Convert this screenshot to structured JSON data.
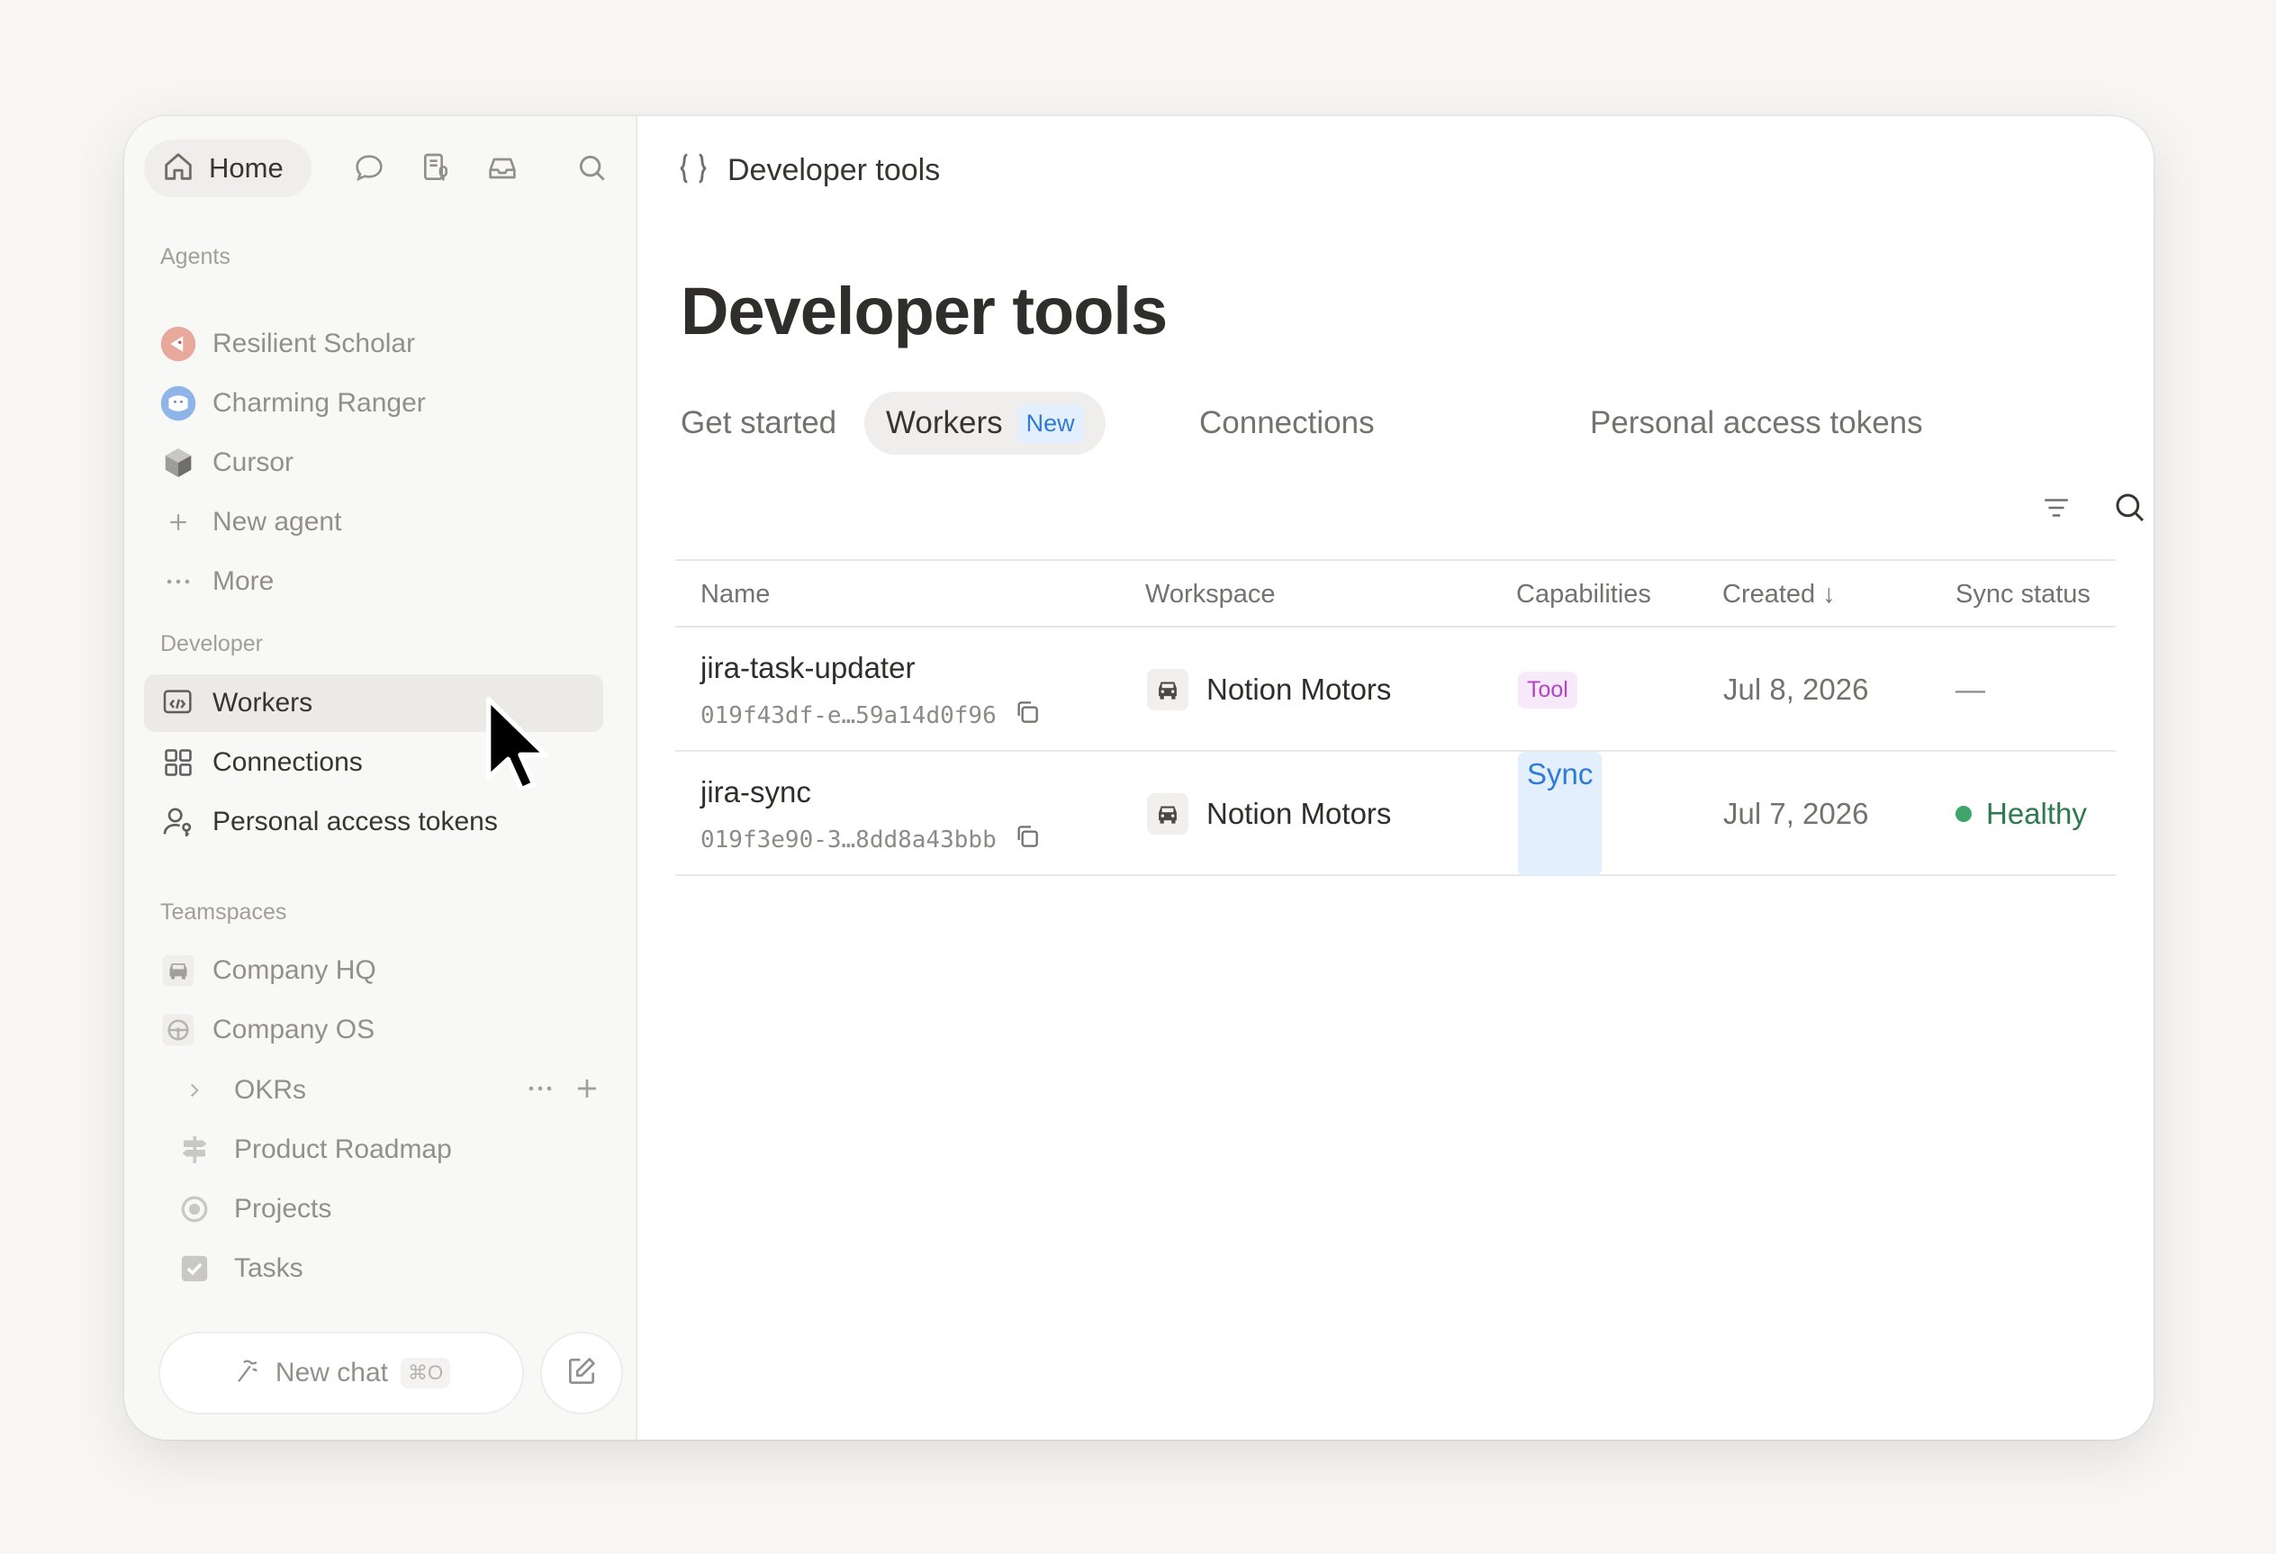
{
  "sidebar": {
    "home_label": "Home",
    "sections": {
      "agents": "Agents",
      "developer": "Developer",
      "teamspaces": "Teamspaces"
    },
    "agents": [
      {
        "label": "Resilient Scholar",
        "color": "#e9a89c"
      },
      {
        "label": "Charming Ranger",
        "color": "#8fb4e8"
      },
      {
        "label": "Cursor",
        "icon": "cube-icon"
      },
      {
        "label": "New agent",
        "icon": "plus-icon"
      },
      {
        "label": "More",
        "icon": "ellipsis-icon"
      }
    ],
    "developer": [
      {
        "label": "Workers",
        "icon": "code-window-icon"
      },
      {
        "label": "Connections",
        "icon": "grid-icon"
      },
      {
        "label": "Personal access tokens",
        "icon": "user-key-icon"
      }
    ],
    "teamspaces": [
      {
        "label": "Company HQ",
        "icon": "car-icon"
      },
      {
        "label": "Company OS",
        "icon": "steering-wheel-icon"
      },
      {
        "label": "OKRs",
        "icon": "chevron-right-icon"
      },
      {
        "label": "Product Roadmap",
        "icon": "signpost-icon"
      },
      {
        "label": "Projects",
        "icon": "target-icon"
      },
      {
        "label": "Tasks",
        "icon": "checkbox-icon"
      }
    ],
    "new_chat": {
      "label": "New chat",
      "shortcut": "⌘O"
    }
  },
  "main": {
    "breadcrumb": "Developer tools",
    "title": "Developer tools",
    "tabs": [
      {
        "label": "Get started"
      },
      {
        "label": "Workers",
        "badge": "New",
        "active": true
      },
      {
        "label": "Connections"
      },
      {
        "label": "Personal access tokens"
      }
    ],
    "table": {
      "columns": [
        "Name",
        "Workspace",
        "Capabilities",
        "Created ↓",
        "Sync status"
      ],
      "rows": [
        {
          "name": "jira-task-updater",
          "id": "019f43df-e…59a14d0f96",
          "workspace": "Notion Motors",
          "capability": "Tool",
          "created": "Jul 8, 2026",
          "sync": "—"
        },
        {
          "name": "jira-sync",
          "id": "019f3e90-3…8dd8a43bbb",
          "workspace": "Notion Motors",
          "capability": "Sync",
          "created": "Jul 7, 2026",
          "sync": "Healthy"
        }
      ]
    }
  },
  "colors": {
    "accent_blue": "#2f7bd6",
    "tool_purple": "#b046c4",
    "healthy_green": "#3fa56b"
  }
}
